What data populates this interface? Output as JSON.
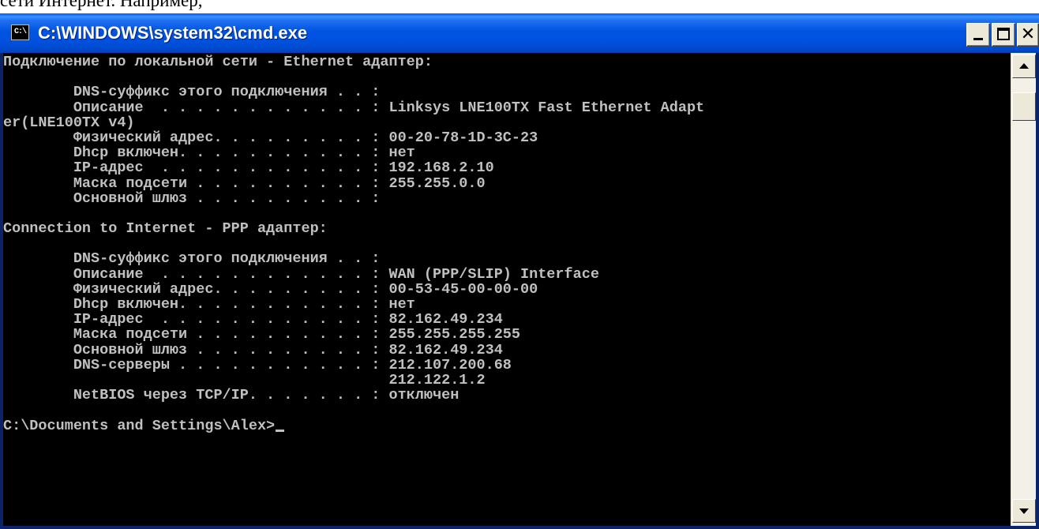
{
  "document": {
    "text_above": "сети Интернет. Например,"
  },
  "window": {
    "title": "C:\\WINDOWS\\system32\\cmd.exe",
    "icon": "cmd-icon",
    "icon_glyph": "C:\\",
    "controls": {
      "minimize": "minimize-icon",
      "maximize": "maximize-icon",
      "close": "close-icon",
      "close_glyph": "✕"
    }
  },
  "console": {
    "lines": [
      "Подключение по локальной сети - Ethernet адаптер:",
      "",
      "        DNS-суффикс этого подключения . . :",
      "        Описание  . . . . . . . . . . . . : Linksys LNE100TX Fast Ethernet Adapt",
      "er(LNE100TX v4)",
      "        Физический адрес. . . . . . . . . : 00-20-78-1D-3C-23",
      "        Dhcp включен. . . . . . . . . . . : нет",
      "        IP-адрес  . . . . . . . . . . . . : 192.168.2.10",
      "        Маска подсети . . . . . . . . . . : 255.255.0.0",
      "        Основной шлюз . . . . . . . . . . :",
      "",
      "Connection to Internet - PPP адаптер:",
      "",
      "        DNS-суффикс этого подключения . . :",
      "        Описание  . . . . . . . . . . . . : WAN (PPP/SLIP) Interface",
      "        Физический адрес. . . . . . . . . : 00-53-45-00-00-00",
      "        Dhcp включен. . . . . . . . . . . : нет",
      "        IP-адрес  . . . . . . . . . . . . : 82.162.49.234",
      "        Маска подсети . . . . . . . . . . : 255.255.255.255",
      "        Основной шлюз . . . . . . . . . . : 82.162.49.234",
      "        DNS-серверы . . . . . . . . . . . : 212.107.200.68",
      "                                            212.122.1.2",
      "        NetBIOS через TCP/IP. . . . . . . : отключен",
      "",
      "C:\\Documents and Settings\\Alex>"
    ]
  },
  "scrollbar": {
    "up_icon": "scroll-up-arrow-icon",
    "down_icon": "scroll-down-arrow-icon",
    "position": 0.0
  },
  "colors": {
    "titlebar": "#0054e3",
    "console_bg": "#000000",
    "console_text": "#c0c0c0",
    "chrome": "#ece9d8"
  }
}
